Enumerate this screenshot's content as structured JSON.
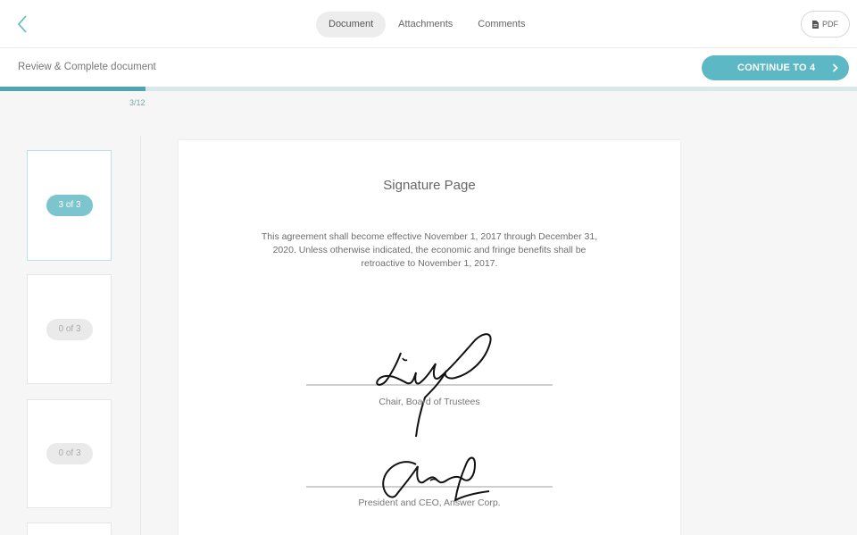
{
  "header": {
    "tabs": [
      {
        "label": "Document",
        "active": true
      },
      {
        "label": "Attachments",
        "active": false
      },
      {
        "label": "Comments",
        "active": false
      }
    ],
    "pdf_label": "PDF"
  },
  "subheader": {
    "title": "Review & Complete document",
    "continue_label": "CONTINUE TO 4"
  },
  "progress": {
    "label": "3/12",
    "fraction": 0.25
  },
  "thumbnails": [
    {
      "badge": "3 of 3",
      "selected": true
    },
    {
      "badge": "0 of 3",
      "selected": false
    },
    {
      "badge": "0 of 3",
      "selected": false
    }
  ],
  "document": {
    "title": "Signature Page",
    "body": "This agreement shall become effective November 1, 2017 through December 31, 2020. Unless otherwise indicated, the economic and fringe benefits shall be retroactive to November 1, 2017.",
    "signers": [
      {
        "caption": "Chair, Board of Trustees"
      },
      {
        "caption": "President and CEO, Answer Corp."
      }
    ]
  },
  "colors": {
    "accent": "#5db8c5",
    "progress": "#4ea6b4"
  },
  "icons": {
    "back": "chevron-left-icon",
    "pdf": "document-icon",
    "continue": "chevron-right-icon"
  }
}
